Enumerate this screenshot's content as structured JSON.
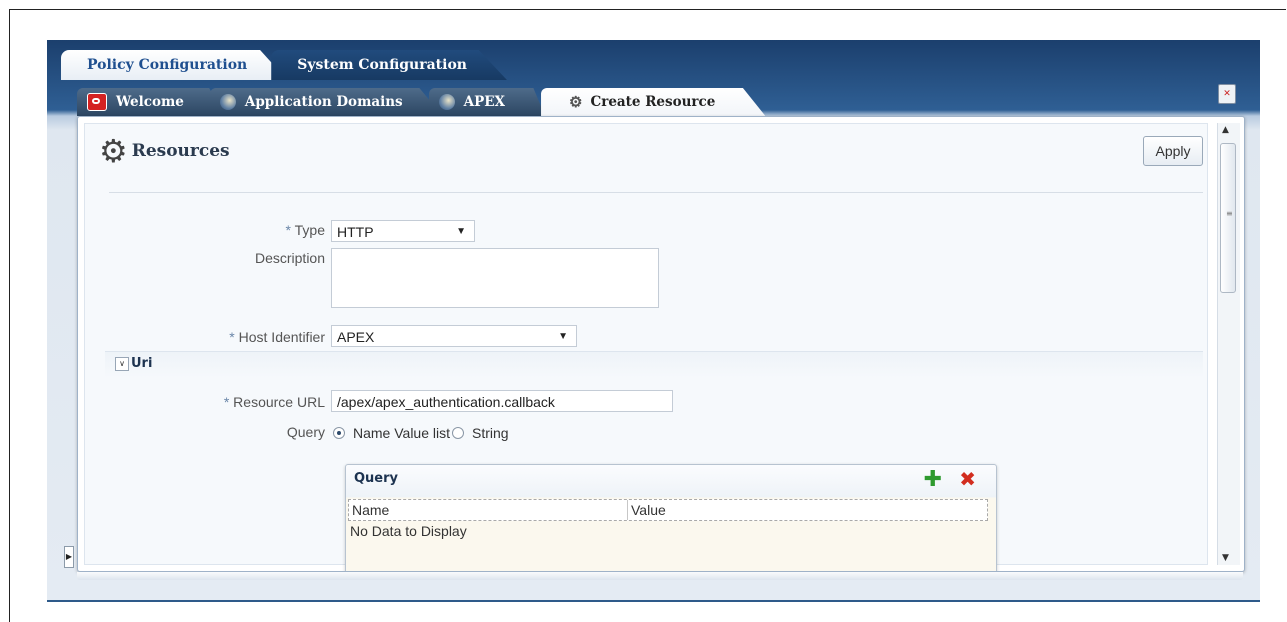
{
  "top_tabs": [
    {
      "label": "Policy Configuration",
      "active": true
    },
    {
      "label": "System Configuration",
      "active": false
    }
  ],
  "doc_tabs": [
    {
      "label": "Welcome",
      "icon": "welcome-icon"
    },
    {
      "label": "Application Domains",
      "icon": "globe-icon"
    },
    {
      "label": "APEX",
      "icon": "globe-icon"
    },
    {
      "label": "Create Resource",
      "icon": "gear-icon",
      "active": true
    }
  ],
  "page": {
    "title": "Resources",
    "apply_label": "Apply"
  },
  "form": {
    "required_marker": "*",
    "type_label": "Type",
    "type_value": "HTTP",
    "description_label": "Description",
    "description_value": "",
    "host_identifier_label": "Host Identifier",
    "host_identifier_value": "APEX"
  },
  "uri": {
    "section_label": "Uri",
    "resource_url_label": "Resource URL",
    "resource_url_value": "/apex/apex_authentication.callback",
    "query_label": "Query",
    "query_options": [
      "Name Value list",
      "String"
    ],
    "query_selected": "Name Value list"
  },
  "query_table": {
    "title": "Query",
    "columns": [
      "Name",
      "Value"
    ],
    "empty_text": "No Data to Display"
  },
  "colors": {
    "header_blue": "#1b3f6d",
    "title_blue": "#1f4f8f",
    "add_green": "#2e9a2e",
    "delete_red": "#d22d1f"
  }
}
